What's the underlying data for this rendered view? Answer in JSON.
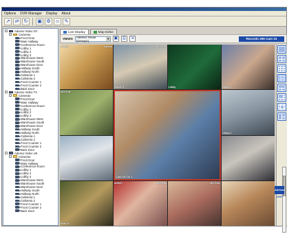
{
  "menu": [
    "Options",
    "DVR Manager",
    "Display",
    "About"
  ],
  "toolbar_icons": [
    "connect-icon",
    "disconnect-icon",
    "refresh-icon",
    "save-icon",
    "settings-icon",
    "user-icon",
    "tools-icon"
  ],
  "tree": [
    {
      "level": 0,
      "type": "server",
      "label": "Adesso Video NY"
    },
    {
      "level": 1,
      "type": "folder",
      "label": "Cameras"
    },
    {
      "level": 2,
      "type": "cam",
      "label": "Front Door"
    },
    {
      "level": 2,
      "type": "cam",
      "label": "Main Hallway"
    },
    {
      "level": 2,
      "type": "cam",
      "label": "Conference Room"
    },
    {
      "level": 2,
      "type": "cam",
      "label": "Lobby 1"
    },
    {
      "level": 2,
      "type": "cam",
      "label": "Lobby 2"
    },
    {
      "level": 2,
      "type": "cam",
      "label": "Lobby 3"
    },
    {
      "level": 2,
      "type": "cam",
      "label": "Warehouse West"
    },
    {
      "level": 2,
      "type": "cam",
      "label": "Warehouse South"
    },
    {
      "level": 2,
      "type": "cam",
      "label": "Warehouse Door"
    },
    {
      "level": 2,
      "type": "cam",
      "label": "Hallway South"
    },
    {
      "level": 2,
      "type": "cam",
      "label": "Hallway North"
    },
    {
      "level": 2,
      "type": "cam",
      "label": "Cafeteria 1"
    },
    {
      "level": 2,
      "type": "cam",
      "label": "Cafeteria 2"
    },
    {
      "level": 2,
      "type": "cam",
      "label": "Front Counter 1"
    },
    {
      "level": 2,
      "type": "cam",
      "label": "Front Counter 2"
    },
    {
      "level": 2,
      "type": "cam",
      "label": "Back Door"
    },
    {
      "level": 0,
      "type": "server",
      "label": "Adesso Video TX"
    },
    {
      "level": 1,
      "type": "folder",
      "label": "Cameras"
    },
    {
      "level": 2,
      "type": "cam",
      "label": "Front Door"
    },
    {
      "level": 2,
      "type": "cam",
      "label": "Main Hallway"
    },
    {
      "level": 2,
      "type": "cam",
      "label": "Conference Room"
    },
    {
      "level": 2,
      "type": "cam",
      "label": "Lobby 1"
    },
    {
      "level": 2,
      "type": "cam",
      "label": "Lobby 2"
    },
    {
      "level": 2,
      "type": "cam",
      "label": "Lobby 3"
    },
    {
      "level": 2,
      "type": "cam",
      "label": "Warehouse West"
    },
    {
      "level": 2,
      "type": "cam",
      "label": "Warehouse South"
    },
    {
      "level": 2,
      "type": "cam",
      "label": "Warehouse Door"
    },
    {
      "level": 2,
      "type": "cam",
      "label": "Hallway South"
    },
    {
      "level": 2,
      "type": "cam",
      "label": "Hallway North"
    },
    {
      "level": 2,
      "type": "cam",
      "label": "Cafeteria 1"
    },
    {
      "level": 2,
      "type": "cam",
      "label": "Cafeteria 2"
    },
    {
      "level": 2,
      "type": "cam",
      "label": "Front Counter 1"
    },
    {
      "level": 2,
      "type": "cam",
      "label": "Front Counter 2"
    },
    {
      "level": 2,
      "type": "cam",
      "label": "Back Door"
    },
    {
      "level": 0,
      "type": "server",
      "label": "Adesso Video UK"
    },
    {
      "level": 1,
      "type": "folder",
      "label": "Cameras"
    },
    {
      "level": 2,
      "type": "cam",
      "label": "Front Door"
    },
    {
      "level": 2,
      "type": "cam",
      "label": "Main Hallway"
    },
    {
      "level": 2,
      "type": "cam",
      "label": "Conference Room"
    },
    {
      "level": 2,
      "type": "cam",
      "label": "Lobby 1"
    },
    {
      "level": 2,
      "type": "cam",
      "label": "Lobby 2"
    },
    {
      "level": 2,
      "type": "cam",
      "label": "Lobby 3"
    },
    {
      "level": 2,
      "type": "cam",
      "label": "Warehouse West"
    },
    {
      "level": 2,
      "type": "cam",
      "label": "Warehouse South"
    },
    {
      "level": 2,
      "type": "cam",
      "label": "Warehouse Door"
    },
    {
      "level": 2,
      "type": "cam",
      "label": "Hallway South"
    },
    {
      "level": 2,
      "type": "cam",
      "label": "Hallway North"
    },
    {
      "level": 2,
      "type": "cam",
      "label": "Cafeteria 1"
    },
    {
      "level": 2,
      "type": "cam",
      "label": "Cafeteria 2"
    },
    {
      "level": 2,
      "type": "cam",
      "label": "Front Counter 1"
    },
    {
      "level": 2,
      "type": "cam",
      "label": "Front Counter 2"
    },
    {
      "level": 2,
      "type": "cam",
      "label": "Back Door"
    }
  ],
  "tabs": [
    {
      "label": "Live Display",
      "active": true
    },
    {
      "label": "Map Editor",
      "active": false
    }
  ],
  "controls": {
    "view_label": "VIEWS",
    "view_value": "Adesso Texas (Group1)",
    "status": "Records 265  Cam 31"
  },
  "cells": [
    {
      "name": "cell-1",
      "tl": "8/08/07",
      "tr": "Adesso",
      "bl": "",
      "bg": "linear-gradient(135deg,#f2d9a8,#c89a52 45%,#7a4a1e)"
    },
    {
      "name": "cell-2",
      "tl": "",
      "tr": "MOTION",
      "bl": "Wsrve 5",
      "bg": "linear-gradient(160deg,#7b93a8,#d6c9b2 50%,#3e4b57)"
    },
    {
      "name": "cell-3",
      "tl": "",
      "tr": "",
      "bl": "Lobby",
      "bg": "linear-gradient(135deg,#0f3a20,#1f6b3a 55%,#0b2414)"
    },
    {
      "name": "cell-4",
      "tl": "",
      "tr": "",
      "bl": "Lobby 1",
      "bg": "linear-gradient(135deg,#6b7fa8,#caa78d 50%,#3a2f2a)"
    },
    {
      "name": "cell-5",
      "tl": "MOTION",
      "tr": "",
      "bl": "",
      "bg": "linear-gradient(140deg,#6f8a4e,#9fb26d 50%,#3d4a2c)"
    },
    {
      "name": "cell-big",
      "tl": "",
      "tr": "",
      "bl": "Conf 1/5 Col 1",
      "bg": "linear-gradient(135deg,#d7c6b0,#b08a65 35%,#5b7fa8 60%,#2e3b52)"
    },
    {
      "name": "cell-8",
      "tl": "",
      "tr": "",
      "bl": "Lobby 2",
      "bg": "linear-gradient(160deg,#bcc7cf,#8794a0 50%,#3e4852)"
    },
    {
      "name": "cell-9",
      "tl": "",
      "tr": "",
      "bl": "Park 2",
      "bg": "linear-gradient(160deg,#9ab0c4,#e2e6ea 45%,#5d6a77)"
    },
    {
      "name": "cell-12",
      "tl": "",
      "tr": "",
      "bl": "",
      "bg": "linear-gradient(150deg,#8a8a90,#c9c5bd 45%,#2d2d35)"
    },
    {
      "name": "cell-13",
      "tl": "",
      "tr": "",
      "bl": "Rear 22",
      "bg": "linear-gradient(140deg,#4d5a2c,#b49a5e 50%,#2c2a1e)"
    },
    {
      "name": "cell-14",
      "tl": "8/08/07",
      "tr": "MOTION",
      "bl": "",
      "bg": "linear-gradient(135deg,#b52f2f,#e0b6a0 45%,#7a4f4f)"
    },
    {
      "name": "cell-15",
      "tl": "",
      "tr": "MOTION",
      "bl": "",
      "bg": "linear-gradient(150deg,#d9b99a,#aa6b5e 50%,#463430)"
    },
    {
      "name": "cell-16",
      "tl": "",
      "tr": "",
      "bl": "",
      "bg": "linear-gradient(150deg,#e7d6b9,#b8875a 45%,#6a4b33)"
    }
  ],
  "layouts": [
    "1x1",
    "2x2",
    "3x3",
    "4x4",
    "1+5",
    "1+7",
    "1+12",
    "custom"
  ],
  "brand": {
    "top": "Adesso",
    "bottom": "DVR"
  }
}
